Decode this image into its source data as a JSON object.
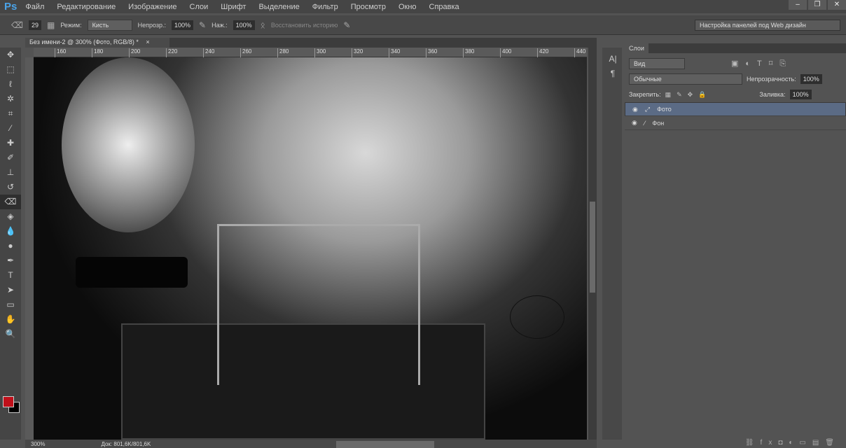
{
  "app": {
    "logo": "Ps",
    "menu": [
      "Файл",
      "Редактирование",
      "Изображение",
      "Слои",
      "Шрифт",
      "Выделение",
      "Фильтр",
      "Просмотр",
      "Окно",
      "Справка"
    ],
    "window_buttons": [
      "–",
      "❐",
      "✕"
    ]
  },
  "options": {
    "brush_size": "29",
    "mode_label": "Режим:",
    "mode_value": "Кисть",
    "opacity_label": "Непрозр.:",
    "opacity_value": "100%",
    "flow_label": "Наж.:",
    "flow_value": "100%",
    "restore_history": "Восстановить историю",
    "workspace": "Настройка панелей под Web дизайн"
  },
  "document": {
    "tab_title": "Без имени-2 @ 300% (Фото, RGB/8) *",
    "close": "×",
    "ruler_ticks": [
      "160",
      "180",
      "200",
      "220",
      "240",
      "260",
      "280",
      "300",
      "320",
      "340",
      "360",
      "380",
      "400",
      "420",
      "440"
    ]
  },
  "status": {
    "zoom": "300%",
    "doc": "Док: 801,6K/801,6K"
  },
  "layers_panel": {
    "tab": "Слои",
    "filter": "Вид",
    "blend_mode": "Обычные",
    "opacity_label": "Непрозрачность:",
    "opacity_value": "100%",
    "lock_label": "Закрепить:",
    "fill_label": "Заливка:",
    "fill_value": "100%",
    "layers": [
      {
        "name": "Фото",
        "selected": true
      },
      {
        "name": "Фон",
        "selected": false
      }
    ]
  },
  "colors": {
    "foreground": "#c0101a",
    "background": "#000000"
  }
}
